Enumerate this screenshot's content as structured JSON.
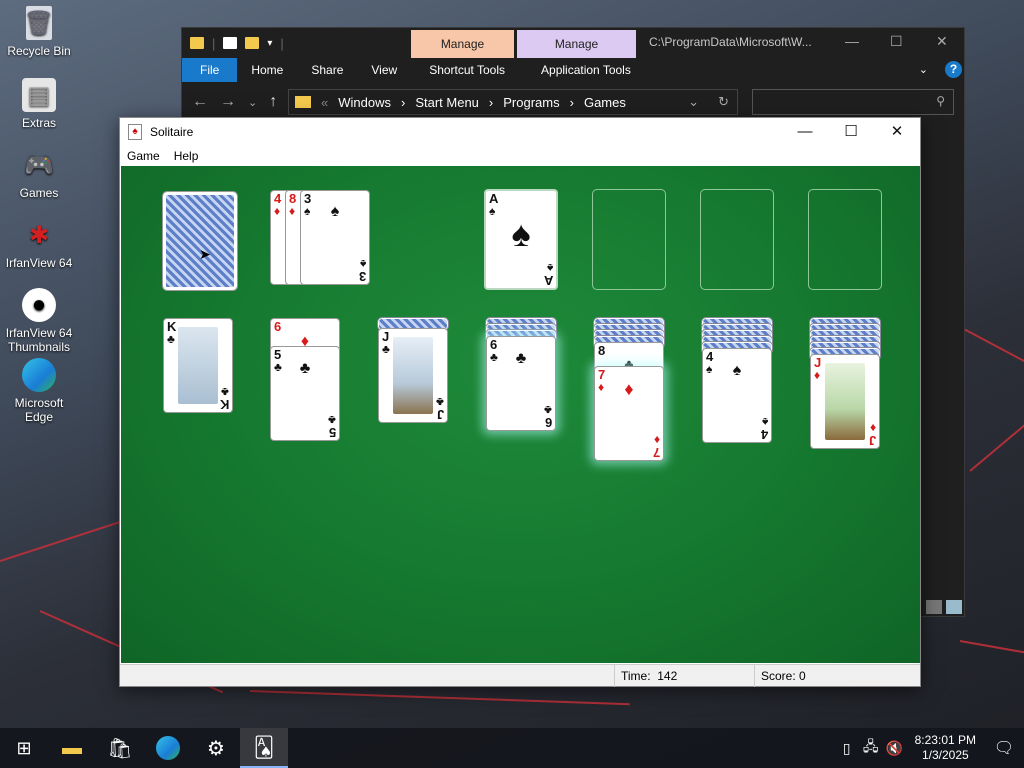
{
  "desktop": {
    "icons": [
      {
        "label": "Recycle Bin",
        "icon": "recycle-bin-icon"
      },
      {
        "label": "Extras",
        "icon": "folder-icon"
      },
      {
        "label": "Games",
        "icon": "gamepad-icon"
      },
      {
        "label": "IrfanView 64",
        "icon": "irfanview-icon"
      },
      {
        "label": "IrfanView 64 Thumbnails",
        "icon": "irfanview-thumbnails-icon"
      },
      {
        "label": "Microsoft Edge",
        "icon": "edge-icon"
      }
    ]
  },
  "explorer": {
    "manage_tab_1": "Manage",
    "manage_tab_2": "Manage",
    "title_path": "C:\\ProgramData\\Microsoft\\W...",
    "ribbon": [
      "File",
      "Home",
      "Share",
      "View",
      "Shortcut Tools",
      "Application Tools"
    ],
    "breadcrumb": [
      "Windows",
      "Start Menu",
      "Programs",
      "Games"
    ],
    "accent": "#1979ca"
  },
  "solitaire": {
    "title": "Solitaire",
    "menu": [
      "Game",
      "Help"
    ],
    "status": {
      "time_label": "Time:",
      "time_value": "142",
      "score_label": "Score:",
      "score_value": "0"
    },
    "waste": [
      {
        "rank": "4",
        "suit": "♦"
      },
      {
        "rank": "8",
        "suit": "♦"
      },
      {
        "rank": "3",
        "suit": "♠"
      }
    ],
    "foundation": [
      {
        "rank": "A",
        "suit": "♠"
      }
    ],
    "tableau": [
      {
        "rank": "K",
        "suit": "♣"
      },
      {
        "rank": "6",
        "suit": "♦"
      },
      {
        "rank": "5",
        "suit": "♣"
      },
      {
        "rank": "J",
        "suit": "♣"
      },
      {
        "rank": "6",
        "suit": "♣"
      },
      {
        "rank": "8",
        "suit": "♣"
      },
      {
        "rank": "7",
        "suit": "♦"
      },
      {
        "rank": "4",
        "suit": "♠"
      },
      {
        "rank": "J",
        "suit": "♦"
      }
    ]
  },
  "taskbar": {
    "pinned": [
      "windows-start-icon",
      "file-explorer-icon",
      "store-icon",
      "edge-icon",
      "settings-gear-icon",
      "solitaire-icon"
    ],
    "time": "8:23:01 PM",
    "date": "1/3/2025"
  }
}
